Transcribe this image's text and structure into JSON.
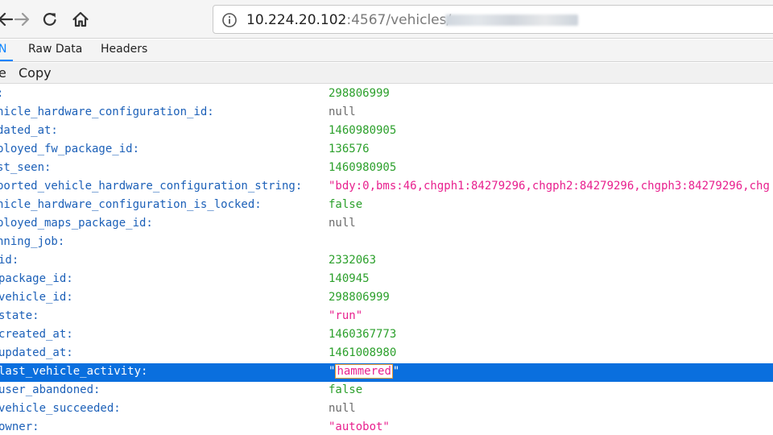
{
  "browser": {
    "url_host": "10.224.20.102",
    "url_path": ":4567/vehicles/"
  },
  "tabs": [
    {
      "label": "JSON",
      "visible_label": "N"
    },
    {
      "label": "Raw Data"
    },
    {
      "label": "Headers"
    }
  ],
  "actions": {
    "save_label": "e",
    "copy_label": "Copy"
  },
  "colors": {
    "key": "#1c60b8",
    "number": "#2ca02c",
    "string": "#e8208e",
    "null": "#6b6b6b",
    "selection": "#0a6fde",
    "tab_active": "#0a84ff"
  },
  "rows": [
    {
      "key": ":",
      "value": "298806999",
      "type": "number"
    },
    {
      "key": "hicle_hardware_configuration_id:",
      "value": "null",
      "type": "null"
    },
    {
      "key": "dated_at:",
      "value": "1460980905",
      "type": "number"
    },
    {
      "key": "ployed_fw_package_id:",
      "value": "136576",
      "type": "number"
    },
    {
      "key": "st_seen:",
      "value": "1460980905",
      "type": "number"
    },
    {
      "key": "ported_vehicle_hardware_configuration_string:",
      "value": "\"bdy:0,bms:46,chgph1:84279296,chgph2:84279296,chgph3:84279296,chg",
      "type": "string"
    },
    {
      "key": "hicle_hardware_configuration_is_locked:",
      "value": "false",
      "type": "bool"
    },
    {
      "key": "ployed_maps_package_id:",
      "value": "null",
      "type": "null"
    },
    {
      "key": "nning_job:",
      "value": "",
      "type": "none"
    },
    {
      "key": "id:",
      "value": "2332063",
      "type": "number"
    },
    {
      "key": "package_id:",
      "value": "140945",
      "type": "number"
    },
    {
      "key": "vehicle_id:",
      "value": "298806999",
      "type": "number"
    },
    {
      "key": "state:",
      "value": "\"run\"",
      "type": "string"
    },
    {
      "key": "created_at:",
      "value": "1460367773",
      "type": "number"
    },
    {
      "key": "updated_at:",
      "value": "1461008980",
      "type": "number"
    },
    {
      "key": "last_vehicle_activity:",
      "value": "hammered",
      "type": "string",
      "selected": true
    },
    {
      "key": "user_abandoned:",
      "value": "false",
      "type": "bool"
    },
    {
      "key": "vehicle_succeeded:",
      "value": "null",
      "type": "null"
    },
    {
      "key": "owner:",
      "value": "\"autobot\"",
      "type": "string"
    }
  ]
}
